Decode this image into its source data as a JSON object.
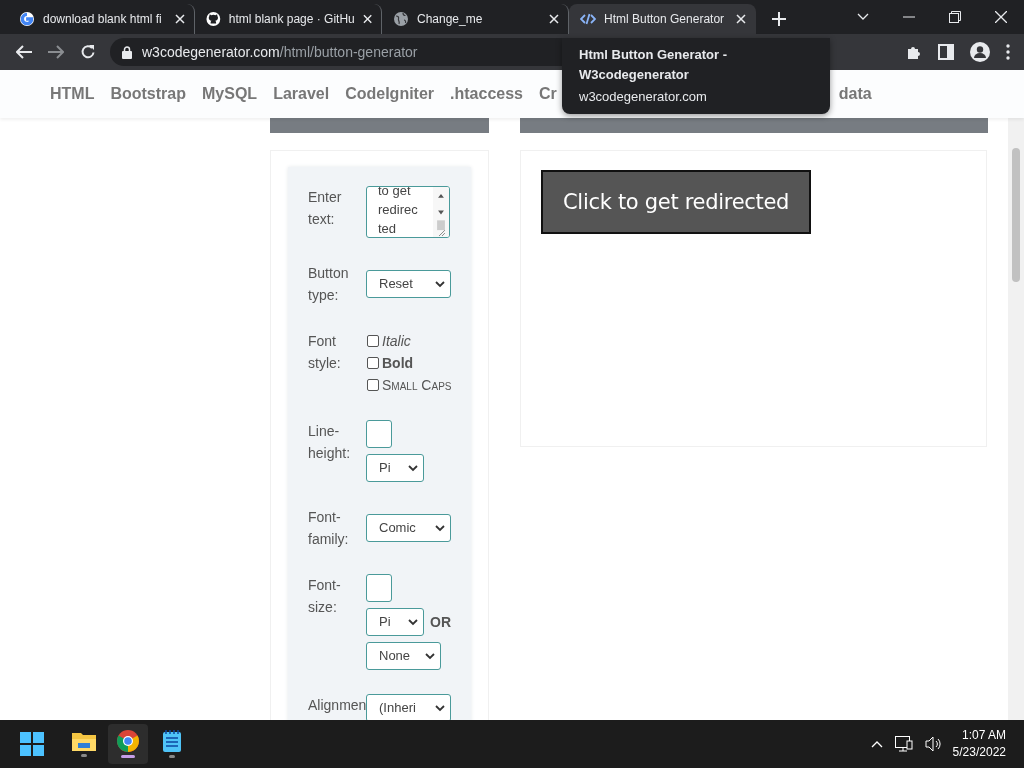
{
  "browser": {
    "tabs": [
      {
        "title": "download blank html fi",
        "kind": "google",
        "selected": false
      },
      {
        "title": "html blank page · GitHu",
        "kind": "github",
        "selected": false
      },
      {
        "title": "Change_me",
        "kind": "globe",
        "selected": false
      },
      {
        "title": "Html Button Generator",
        "kind": "code",
        "selected": true
      }
    ],
    "address": {
      "domain": "w3codegenerator.com",
      "path": "/html/button-generator"
    },
    "tooltip": {
      "title": "Html Button Generator - W3codegenerator",
      "domain": "w3codegenerator.com"
    }
  },
  "site_nav": [
    "HTML",
    "Bootstrap",
    "MySQL",
    "Laravel",
    "CodeIgniter",
    ".htaccess",
    "Cr",
    "data"
  ],
  "form": {
    "fields": [
      {
        "label": "Enter text:",
        "kind": "textarea",
        "lines": [
          "to get",
          "redirec",
          "ted"
        ]
      },
      {
        "label": "Button type:",
        "kind": "select",
        "value": "Reset"
      },
      {
        "label": "Font style:",
        "kind": "styles",
        "options": [
          {
            "label": "Italic",
            "kind": "italic",
            "checked": false
          },
          {
            "label": "Bold",
            "kind": "bold",
            "checked": false
          },
          {
            "label": "Small Caps",
            "kind": "small-caps",
            "checked": false
          }
        ]
      },
      {
        "label": "Line-height:",
        "kind": "number-unit",
        "unit": "Pi"
      },
      {
        "label": "Font-family:",
        "kind": "select",
        "value": "Comic"
      },
      {
        "label": "Font-size:",
        "kind": "number-unit-or",
        "unit": "Pi",
        "or": "OR",
        "alt": "None"
      },
      {
        "label": "Alignmen",
        "kind": "select",
        "value": "(Inheri"
      }
    ]
  },
  "preview": {
    "button_label": "Click to get redirected"
  },
  "taskbar": {
    "apps": [
      {
        "kind": "explorer",
        "selected": false
      },
      {
        "kind": "chrome",
        "selected": true
      },
      {
        "kind": "notepad",
        "selected": false
      }
    ],
    "time": "1:07 AM",
    "date": "5/23/2022"
  }
}
